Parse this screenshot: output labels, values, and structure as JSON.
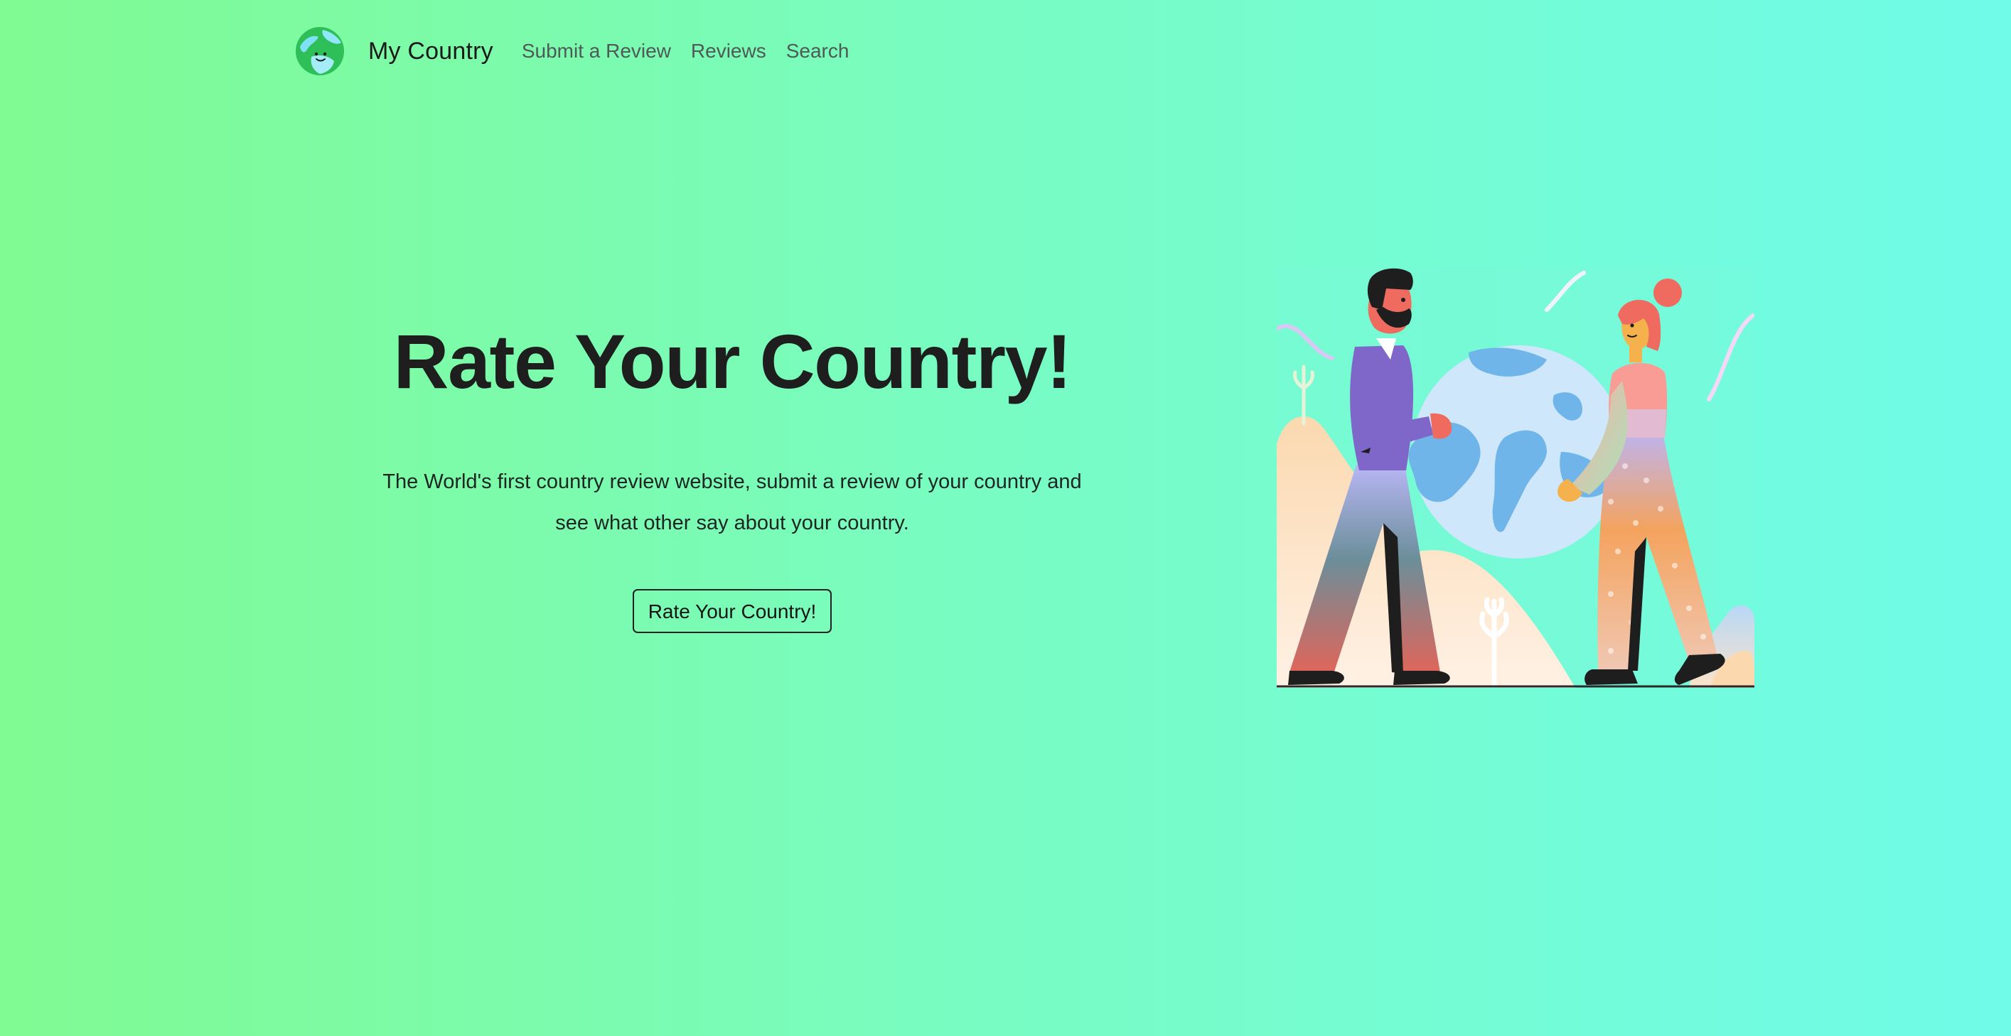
{
  "navbar": {
    "brand": "My Country",
    "brand_icon": "globe-logo-icon",
    "links": [
      {
        "label": "Submit a Review"
      },
      {
        "label": "Reviews"
      },
      {
        "label": "Search"
      }
    ]
  },
  "hero": {
    "title": "Rate Your Country!",
    "description": "The World's first country review website, submit a review of your country and see what other say about your country.",
    "button_label": "Rate Your Country!"
  },
  "illustration": {
    "icon": "people-holding-globe-illustration"
  },
  "colors": {
    "background_left": "#80fa92",
    "background_right": "#6ffbe8",
    "text_dark": "#1e1e1e",
    "nav_link": "#4e5a55"
  }
}
